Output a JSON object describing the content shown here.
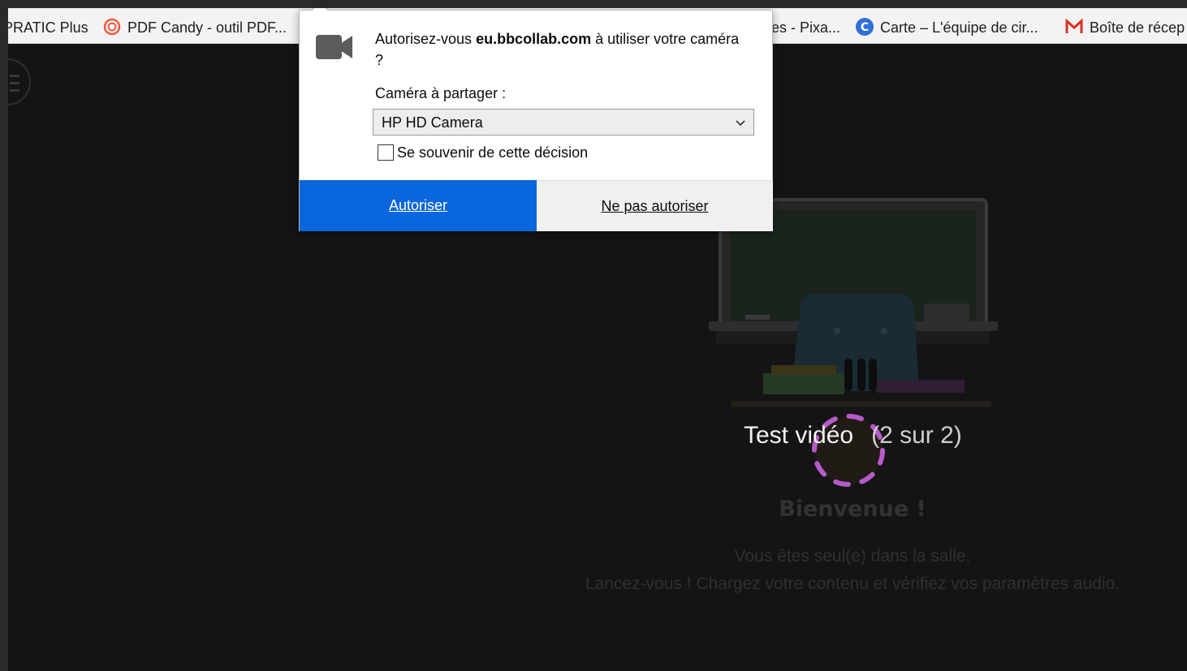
{
  "bookmarks": [
    {
      "label": "PRATIC Plus",
      "icon": "none"
    },
    {
      "label": "PDF Candy - outil PDF...",
      "icon": "pdf-candy-icon"
    },
    {
      "label": "es - Pixa...",
      "icon": "none"
    },
    {
      "label": "Carte – L'équipe de cir...",
      "icon": "carte-c-icon"
    },
    {
      "label": "Boîte de récep",
      "icon": "gmail-icon"
    }
  ],
  "dialog": {
    "prompt_prefix": "Autorisez-vous ",
    "prompt_domain": "eu.bbcollab.com",
    "prompt_suffix": " à utiliser votre caméra ?",
    "camera_label": "Caméra à partager :",
    "camera_selected": "HP HD Camera",
    "remember_label": "Se souvenir de cette décision",
    "remember_checked": false,
    "allow_label": "Autoriser",
    "deny_label": "Ne pas autoriser"
  },
  "session": {
    "test_title": "Test vidéo",
    "test_step": "(2 sur 2)",
    "welcome": "Bienvenue !",
    "line1": "Vous êtes seul(e) dans la salle.",
    "line2": "Lancez-vous ! Chargez votre contenu et vérifiez vos paramètres audio."
  },
  "colors": {
    "allow_button": "#0a66dc",
    "spinner": "#b65bc9",
    "background": "#141414"
  }
}
